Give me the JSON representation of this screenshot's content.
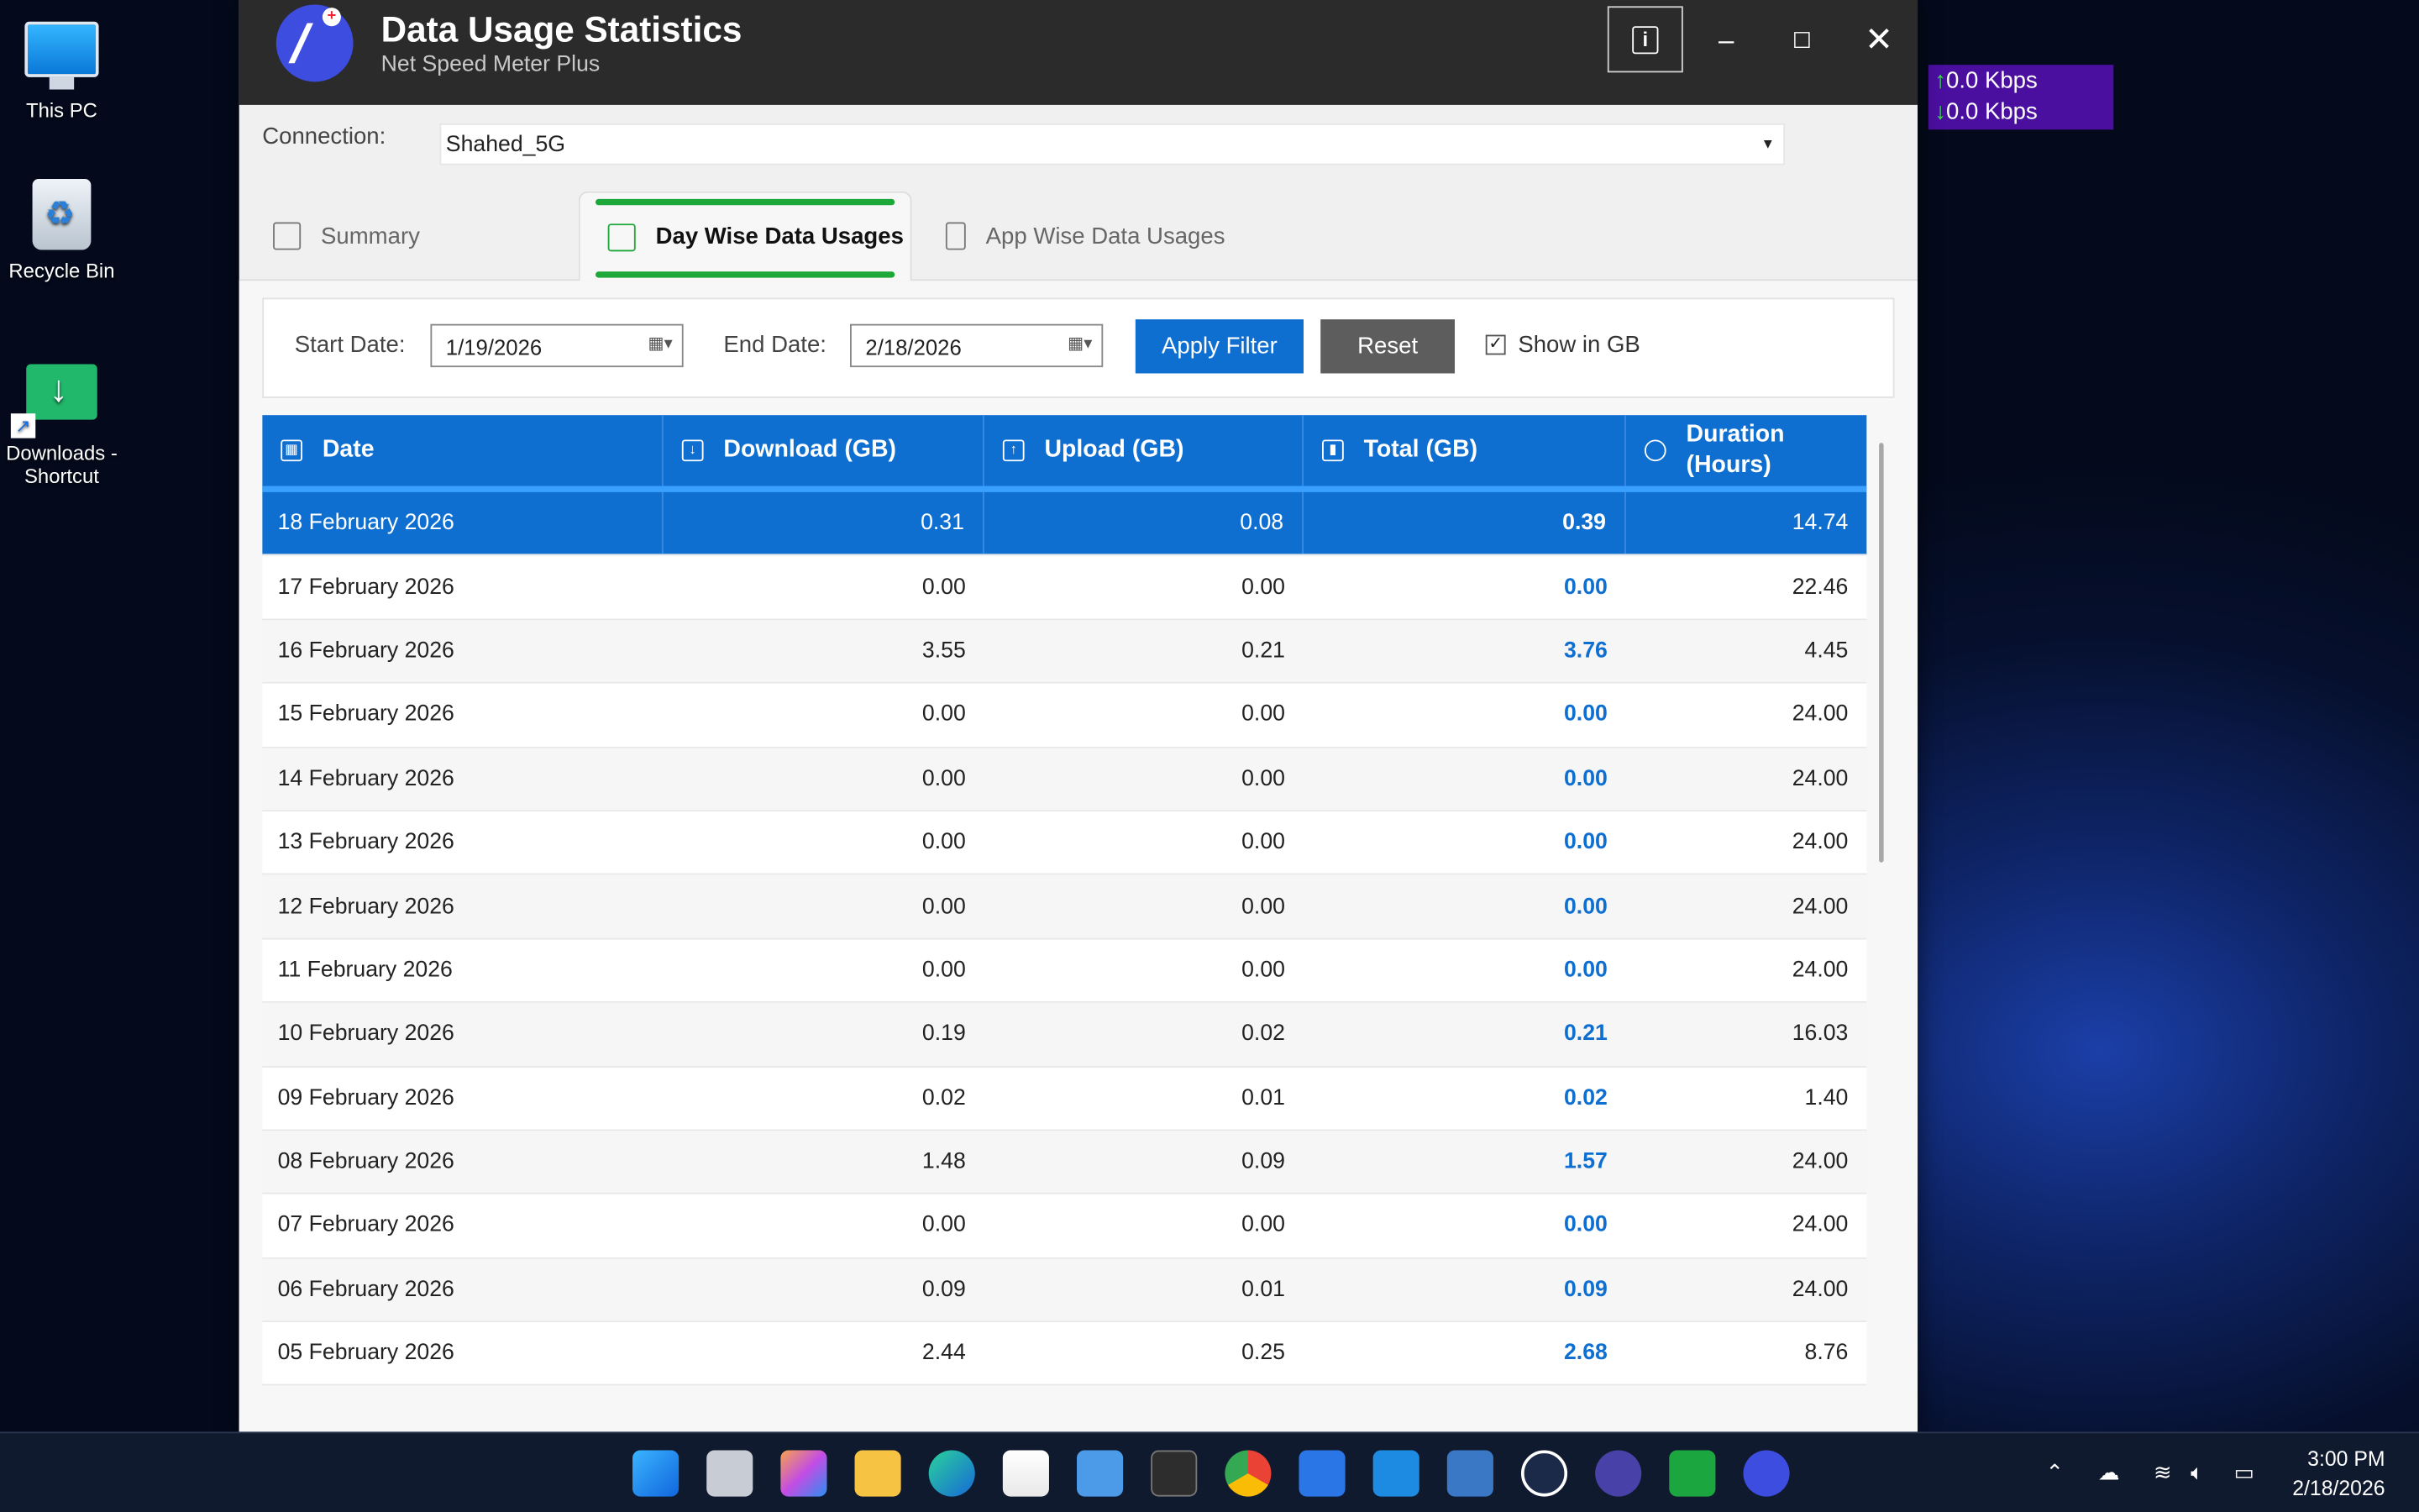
{
  "desktop": {
    "icons": [
      {
        "label": "This PC"
      },
      {
        "label": "Recycle Bin"
      },
      {
        "label": "Downloads - Shortcut"
      }
    ]
  },
  "speed_widget": {
    "upload": "0.0 Kbps",
    "download": "0.0 Kbps",
    "bg_color": "#4b0fa0"
  },
  "window": {
    "title": "Data Usage Statistics",
    "subtitle": "Net Speed Meter Plus",
    "info_icon": "i",
    "connection_label": "Connection:",
    "connection_value": "Shahed_5G",
    "tabs": [
      {
        "label": "Summary",
        "icon": "bar-chart-icon",
        "active": false
      },
      {
        "label": "Day Wise Data Usages",
        "icon": "calendar-icon",
        "active": true
      },
      {
        "label": "App Wise Data Usages",
        "icon": "app-list-icon",
        "active": false
      }
    ],
    "filter": {
      "start_label": "Start Date:",
      "start_value": "1/19/2026",
      "end_label": "End Date:",
      "end_value": "2/18/2026",
      "apply_label": "Apply Filter",
      "reset_label": "Reset",
      "show_gb_label": "Show in GB",
      "show_gb_checked": true
    },
    "table": {
      "columns": [
        "Date",
        "Download (GB)",
        "Upload (GB)",
        "Total (GB)",
        "Duration (Hours)"
      ],
      "rows": [
        [
          "18 February 2026",
          "0.31",
          "0.08",
          "0.39",
          "14.74"
        ],
        [
          "17 February 2026",
          "0.00",
          "0.00",
          "0.00",
          "22.46"
        ],
        [
          "16 February 2026",
          "3.55",
          "0.21",
          "3.76",
          "4.45"
        ],
        [
          "15 February 2026",
          "0.00",
          "0.00",
          "0.00",
          "24.00"
        ],
        [
          "14 February 2026",
          "0.00",
          "0.00",
          "0.00",
          "24.00"
        ],
        [
          "13 February 2026",
          "0.00",
          "0.00",
          "0.00",
          "24.00"
        ],
        [
          "12 February 2026",
          "0.00",
          "0.00",
          "0.00",
          "24.00"
        ],
        [
          "11 February 2026",
          "0.00",
          "0.00",
          "0.00",
          "24.00"
        ],
        [
          "10 February 2026",
          "0.19",
          "0.02",
          "0.21",
          "16.03"
        ],
        [
          "09 February 2026",
          "0.02",
          "0.01",
          "0.02",
          "1.40"
        ],
        [
          "08 February 2026",
          "1.48",
          "0.09",
          "1.57",
          "24.00"
        ],
        [
          "07 February 2026",
          "0.00",
          "0.00",
          "0.00",
          "24.00"
        ],
        [
          "06 February 2026",
          "0.09",
          "0.01",
          "0.09",
          "24.00"
        ],
        [
          "05 February 2026",
          "2.44",
          "0.25",
          "2.68",
          "8.76"
        ]
      ],
      "selected_row": 0
    },
    "accent_color": "#0f6fd1",
    "tab_accent_color": "#1fa83a"
  },
  "taskbar": {
    "apps": [
      "start-icon",
      "task-view-icon",
      "copilot-icon",
      "file-explorer-icon",
      "edge-icon",
      "store-icon",
      "photos-icon",
      "terminal-icon",
      "chrome-icon",
      "app-icon",
      "vscode-icon",
      "remote-desktop-icon",
      "speedometer-icon",
      "settings-chip-icon",
      "updown-icon",
      "net-speed-meter-icon"
    ],
    "time": "3:00 PM",
    "date": "2/18/2026"
  }
}
